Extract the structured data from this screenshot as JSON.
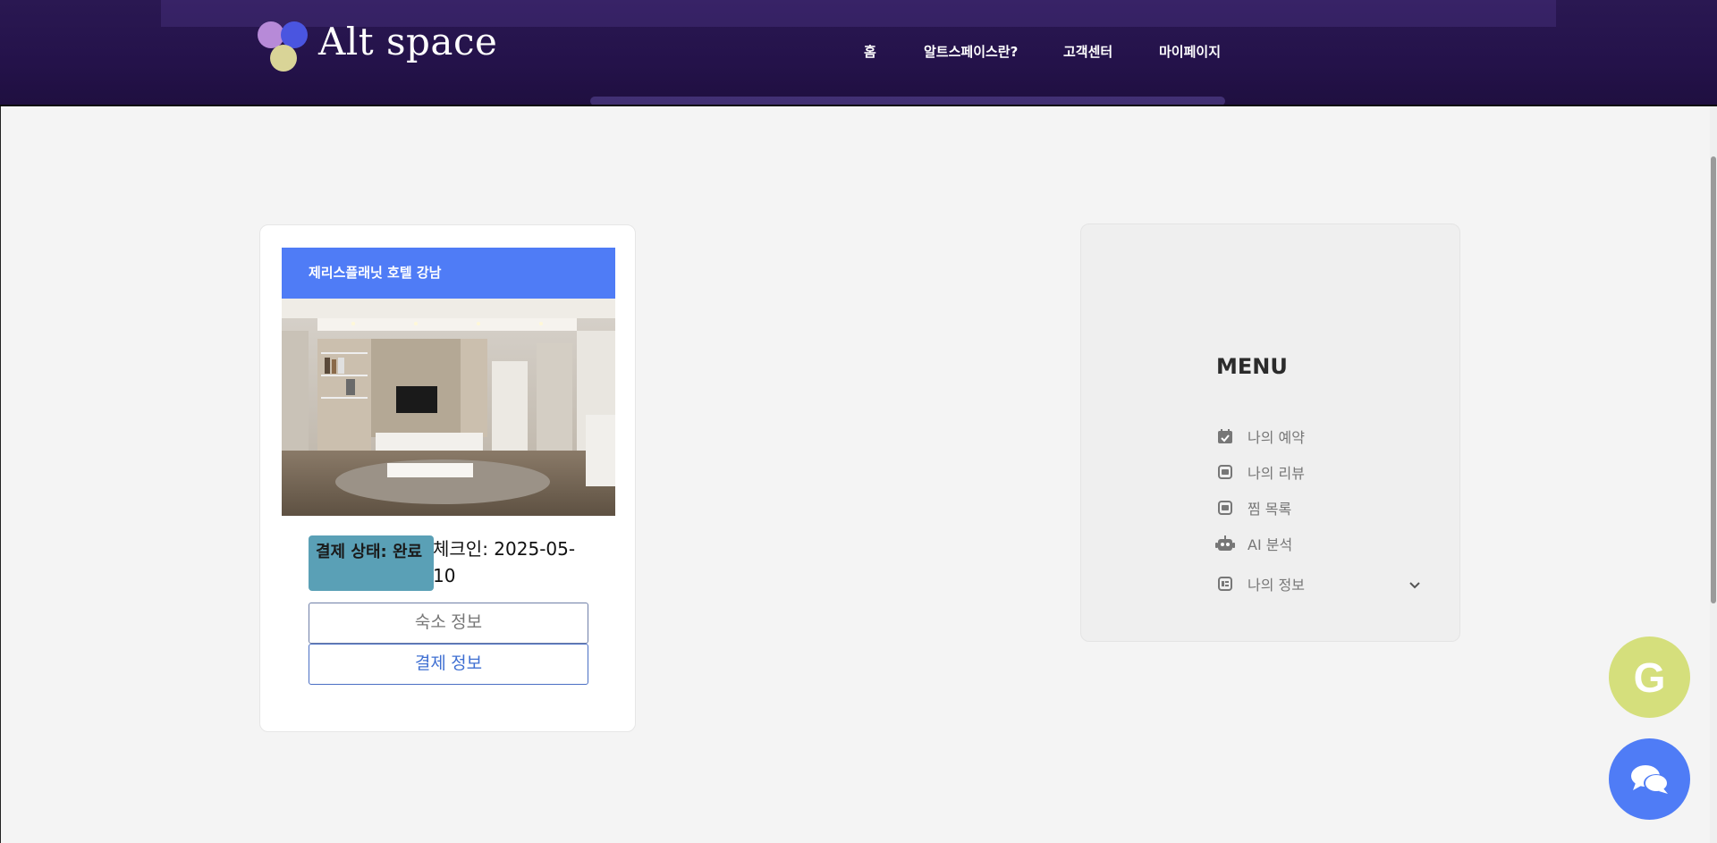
{
  "brand": {
    "name": "Alt space"
  },
  "nav": {
    "items": [
      {
        "label": "홈"
      },
      {
        "label": "알트스페이스란?"
      },
      {
        "label": "고객센터"
      },
      {
        "label": "마이페이지"
      }
    ]
  },
  "reservation": {
    "hotel_name": "제리스플래닛 호텔 강남",
    "photo_icon": "hotel-room-photo",
    "status": "결제 상태: 완료",
    "checkin": "체크인: 2025-05-10",
    "stay_info_button": "숙소 정보",
    "payment_info_button": "결제 정보"
  },
  "menu": {
    "heading": "MENU",
    "items": [
      {
        "label": "나의 예약",
        "icon": "calendar-check-icon"
      },
      {
        "label": "나의 리뷰",
        "icon": "review-icon"
      },
      {
        "label": "찜 목록",
        "icon": "wishlist-icon"
      },
      {
        "label": "AI 분석",
        "icon": "robot-icon"
      },
      {
        "label": "나의 정보",
        "icon": "id-card-icon",
        "expandable": true
      }
    ]
  },
  "floating": {
    "g_button_label": "G",
    "chat_icon": "chat-bubbles-icon"
  },
  "colors": {
    "header_bg": "#2a1852",
    "accent_blue": "#4f7cf6",
    "status_badge": "#5aa0b6",
    "g_button": "#d5df7c"
  }
}
